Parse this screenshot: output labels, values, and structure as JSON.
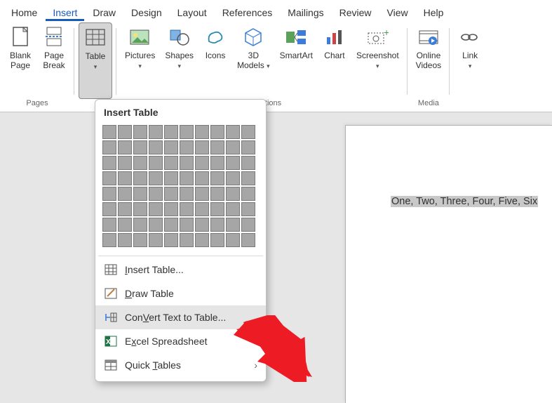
{
  "tabs": {
    "home": "Home",
    "insert": "Insert",
    "draw": "Draw",
    "design": "Design",
    "layout": "Layout",
    "references": "References",
    "mailings": "Mailings",
    "review": "Review",
    "view": "View",
    "help": "Help"
  },
  "ribbon": {
    "pages_group": "Pages",
    "illustrations_group": "Illustrations",
    "media_group": "Media",
    "blank_page": "Blank\nPage",
    "page_break": "Page\nBreak",
    "table": "Table",
    "pictures": "Pictures",
    "shapes": "Shapes",
    "icons": "Icons",
    "models3d": "3D\nModels",
    "smartart": "SmartArt",
    "chart": "Chart",
    "screenshot": "Screenshot",
    "online_videos": "Online\nVideos",
    "link": "Link"
  },
  "dropdown": {
    "title": "Insert Table",
    "insert_table": "Insert Table...",
    "draw_table": "Draw Table",
    "convert": "Convert Text to Table...",
    "excel": "Excel Spreadsheet",
    "quick_tables": "Quick Tables",
    "ak": {
      "i": "I",
      "d": "D",
      "v": "V",
      "x": "x",
      "t": "T"
    }
  },
  "document": {
    "text": "One, Two, Three, Four, Five, Six"
  }
}
